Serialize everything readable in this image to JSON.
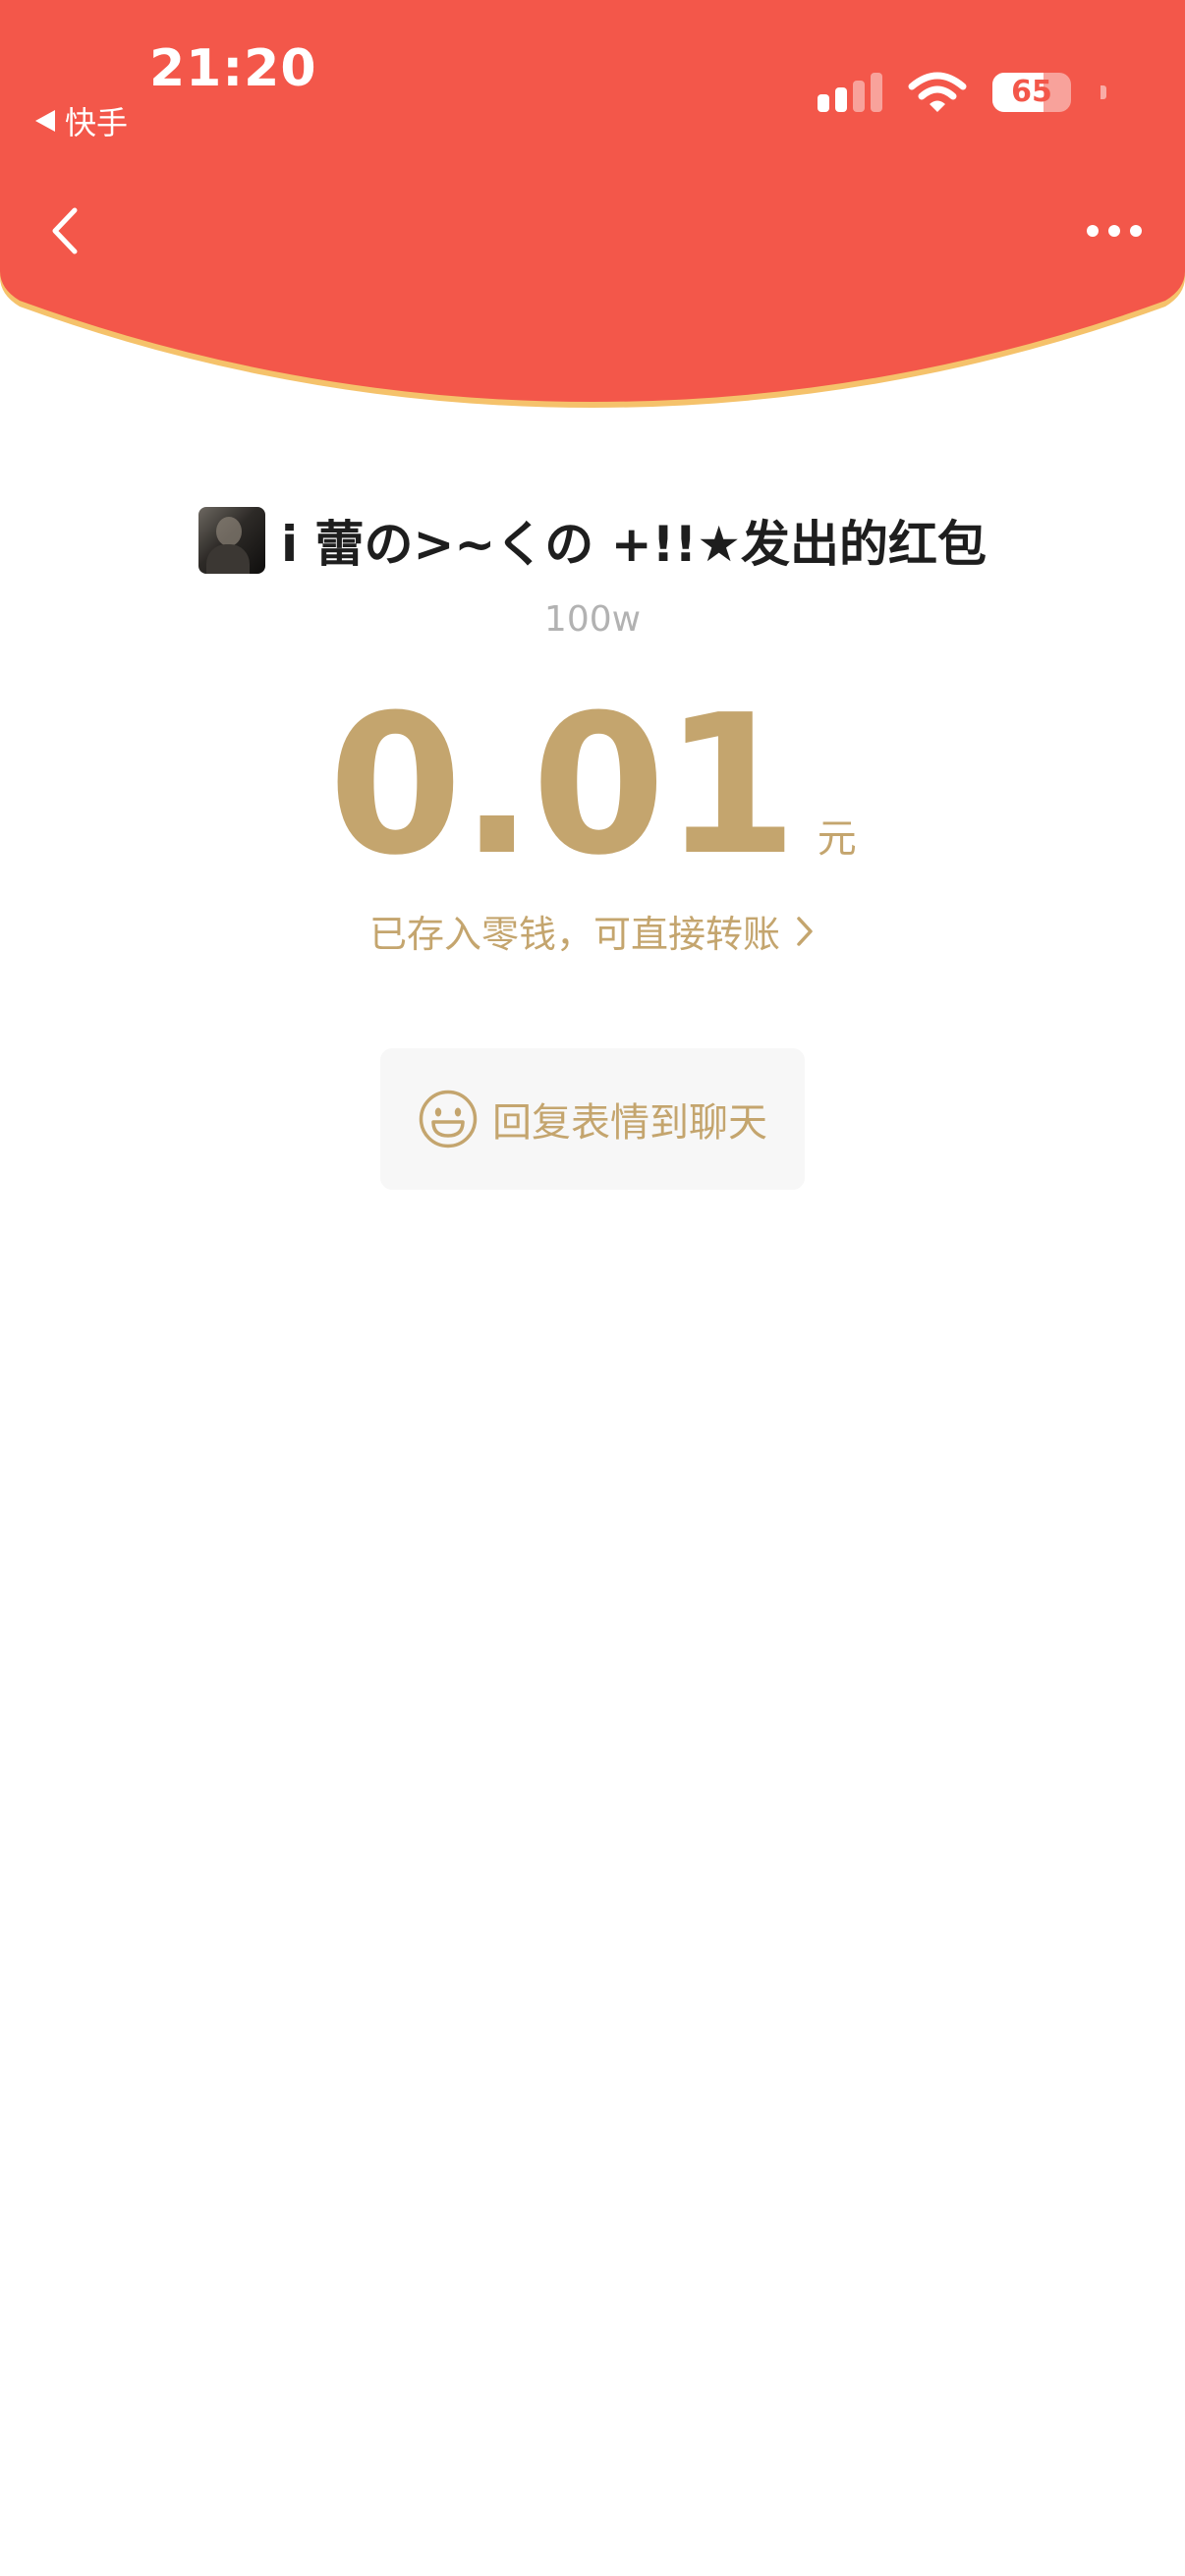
{
  "status_bar": {
    "time": "21:20",
    "back_app_label": "快手",
    "battery_level": "65",
    "battery_fraction": 0.65
  },
  "nav": {
    "back_icon": "chevron-left-icon",
    "more_icon": "more-horizontal-icon"
  },
  "colors": {
    "header_red": "#f3574a",
    "header_edge": "#f5c26b",
    "gold": "#c4a56e"
  },
  "red_packet": {
    "sender_title": "i 蕾の>~くの +!!★发出的红包",
    "subtitle": "100w",
    "amount": "0.01",
    "unit": "元",
    "stored_notice": "已存入零钱，可直接转账",
    "reply_button": "回复表情到聊天"
  }
}
